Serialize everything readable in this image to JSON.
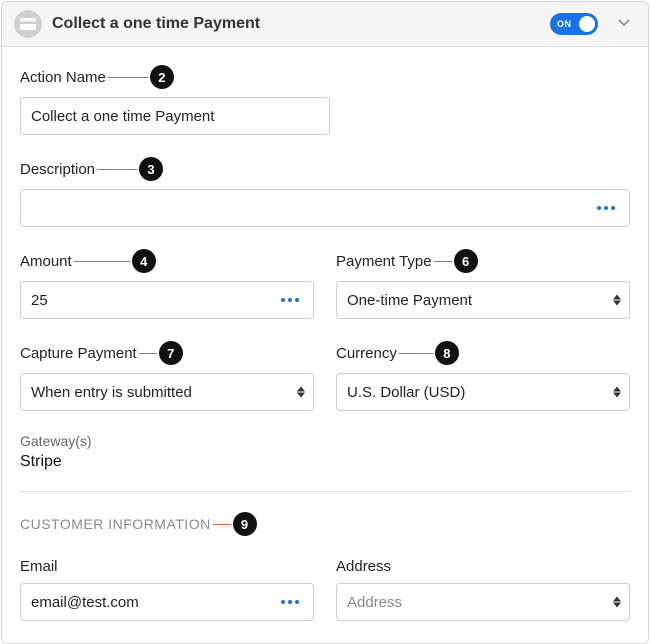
{
  "header": {
    "title": "Collect a one time Payment",
    "toggle_label": "ON"
  },
  "fields": {
    "action_name": {
      "label": "Action Name",
      "value": "Collect a one time Payment",
      "num": "2"
    },
    "description": {
      "label": "Description",
      "value": "",
      "num": "3"
    },
    "amount": {
      "label": "Amount",
      "value": "25",
      "num": "4"
    },
    "payment_type": {
      "label": "Payment Type",
      "value": "One-time Payment",
      "num": "6"
    },
    "capture_payment": {
      "label": "Capture Payment",
      "value": "When entry is submitted",
      "num": "7"
    },
    "currency": {
      "label": "Currency",
      "value": "U.S. Dollar (USD)",
      "num": "8"
    },
    "gateway": {
      "label": "Gateway(s)",
      "value": "Stripe"
    },
    "customer_info_heading": "CUSTOMER INFORMATION",
    "customer_info_num": "9",
    "email": {
      "label": "Email",
      "value": "email@test.com"
    },
    "address": {
      "label": "Address",
      "value": "Address"
    }
  }
}
